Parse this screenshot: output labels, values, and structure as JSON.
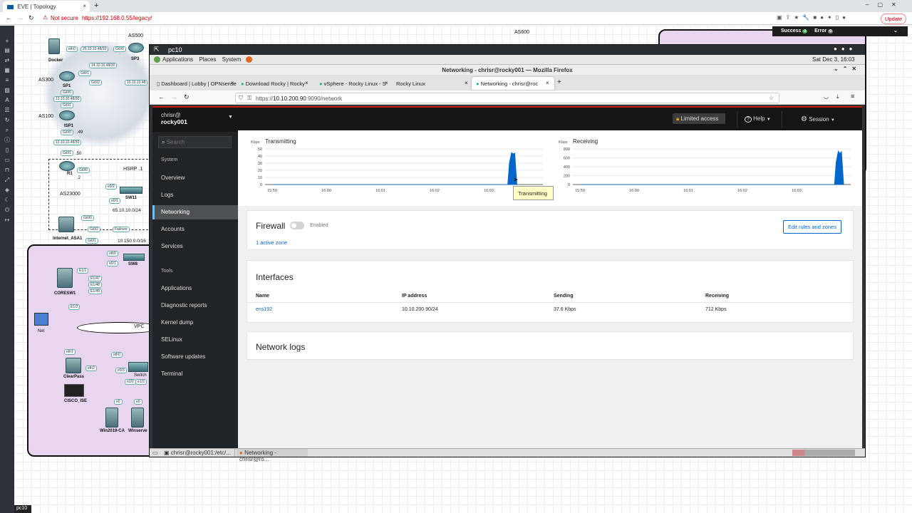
{
  "chrome": {
    "tab_title": "EVE | Topology",
    "security": "Not secure",
    "url": "https://192.168.0.55/legacy/",
    "update_label": "Update"
  },
  "eve": {
    "notify_success": "Success",
    "notify_success_count": "0",
    "notify_error": "Error",
    "notify_error_count": "0",
    "bottom_tab": "pc10",
    "nodes": {
      "docker": "Docker",
      "as500": "AS500",
      "sp3": "SP3",
      "as300": "AS300",
      "sp1": "SP1",
      "as100": "AS100",
      "isp1": "ISP1",
      "r1": "R1",
      "hsrp": "HSRP .1",
      "as23000": "AS23000",
      "sw11": "SW11",
      "net65": "65.10.10.0/24",
      "asa1": "Internet_ASA1",
      "failover": "Failover",
      "net10150": "10.150.0.0/16",
      "sw8": "SW8",
      "coresw1": "CORESW1",
      "net": "Net",
      "vpc": "VPC",
      "clearpass": "ClearPass",
      "cisco_ise": "CISCO_ISE",
      "win2019": "Win2019-CA",
      "winserv": "Winserve",
      "switch": "Switch",
      "as600": "AS600"
    },
    "links": {
      "l1": "25.10.10.48/30",
      "l2": "14.10.10.48/30",
      "l3": "15.10.10.48",
      "l4": "13.10.10.48/30",
      "l5": "12.10.10.48/30",
      "e0_0": "eth0",
      "gi0_1": "Gi0/1",
      "gi0_0": "Gi0/0",
      "gi0_2": "Gi0/2",
      "e0_2": "e0/2",
      "e0_1": "e0/1",
      "e1_1": "E1/1",
      "e1_47": "E1/47",
      "e1_48": "E1/48",
      "e1_49": "E1/49",
      "e1_2": "E1/2",
      "eth1": "eth1",
      "eth2": "eth2",
      "e2_0": "e2/0",
      "e0_3": "e0/3",
      "e1_2b": "e1/2",
      "e0": "e0",
      "d49": ".49",
      "d50": ".50",
      "d2": ".2"
    }
  },
  "vnc": {
    "window_title": "pc10",
    "gnome_menu": [
      "Applications",
      "Places",
      "System"
    ],
    "clock": "Sat Dec 3, 16:03",
    "firefox_title": "Networking - chrisr@rocky001 — Mozilla Firefox",
    "tabs": [
      {
        "label": "Dashboard | Lobby | OPNsense"
      },
      {
        "label": "Download Rocky | Rocky"
      },
      {
        "label": "vSphere - Rocky Linux - S"
      },
      {
        "label": "Rocky Linux"
      },
      {
        "label": "Networking - chrisr@roc"
      }
    ],
    "url_prefix": "https://",
    "url_host": "10.10.200.90",
    "url_rest": ":9090/network",
    "taskbar": [
      "chrisr@rocky001:/etc/...",
      "Networking - chrisr@ro..."
    ]
  },
  "cockpit": {
    "user": "chrisr@",
    "host": "rocky001",
    "search_placeholder": "Search",
    "section_system": "System",
    "nav_system": [
      "Overview",
      "Logs",
      "Networking",
      "Accounts",
      "Services"
    ],
    "section_tools": "Tools",
    "nav_tools": [
      "Applications",
      "Diagnostic reports",
      "Kernel dump",
      "SELinux",
      "Software updates",
      "Terminal"
    ],
    "limited_access": "Limited access",
    "help": "Help",
    "session": "Session",
    "tooltip": "Transmitting",
    "firewall": {
      "title": "Firewall",
      "status": "Enabled",
      "zones": "1 active zone",
      "edit_button": "Edit rules and zones"
    },
    "interfaces": {
      "title": "Interfaces",
      "columns": [
        "Name",
        "IP address",
        "Sending",
        "Receiving"
      ],
      "rows": [
        [
          "ens192",
          "10.10.200.90/24",
          "37.6 Kbps",
          "712 Kbps"
        ]
      ]
    },
    "network_logs": "Network logs"
  },
  "chart_data": [
    {
      "type": "area",
      "title": "Transmitting",
      "ylabel": "Kbps",
      "ylim": [
        0,
        50
      ],
      "yticks": [
        "50",
        "40",
        "30",
        "20",
        "10",
        "0"
      ],
      "xticks": [
        "15:59",
        "16:00",
        "16:01",
        "16:02",
        "16:03"
      ],
      "x": [
        0,
        1,
        2,
        3,
        4,
        4.35,
        4.38,
        4.42,
        4.45,
        4.48,
        4.52
      ],
      "values": [
        0,
        0,
        0,
        0,
        0,
        0,
        30,
        45,
        43,
        44,
        0
      ],
      "color": "#0066cc"
    },
    {
      "type": "area",
      "title": "Receiving",
      "ylabel": "Kbps",
      "ylim": [
        0,
        800
      ],
      "yticks": [
        "800",
        "600",
        "400",
        "200",
        "0"
      ],
      "xticks": [
        "15:59",
        "16:00",
        "16:01",
        "16:02",
        "16:03"
      ],
      "x": [
        0,
        1,
        2,
        3,
        4,
        4.7,
        4.73,
        4.77,
        4.8,
        4.83,
        4.87
      ],
      "values": [
        0,
        0,
        0,
        0,
        0,
        0,
        500,
        750,
        700,
        740,
        0
      ],
      "color": "#0066cc"
    }
  ]
}
